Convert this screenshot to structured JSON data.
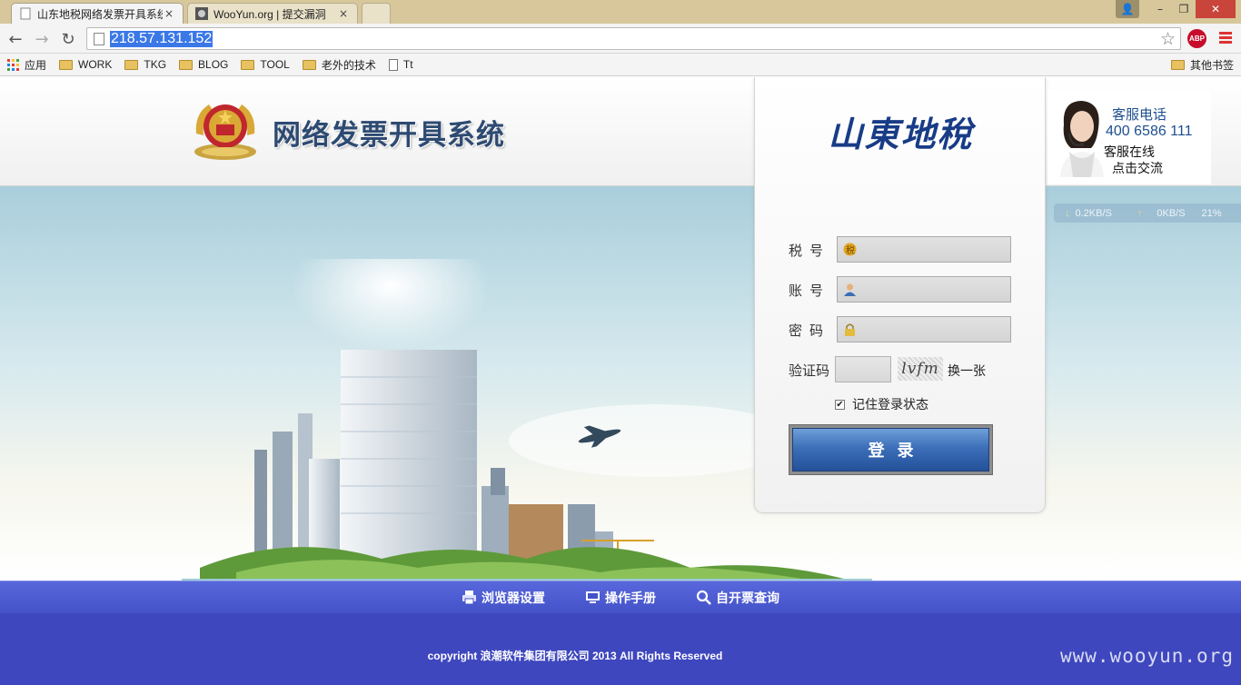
{
  "browser": {
    "tabs": [
      {
        "title": "山东地税网络发票开具系统",
        "active": true,
        "close": "×"
      },
      {
        "title": "WooYun.org | 提交漏洞",
        "active": false,
        "close": "×"
      }
    ],
    "window_controls": {
      "user": "👤",
      "minimize": "–",
      "restore": "❐",
      "close": "✕"
    },
    "nav": {
      "back": "←",
      "forward": "→",
      "reload": "↻"
    },
    "url": "218.57.131.152",
    "bookmark_star": "☆",
    "abp_label": "ABP",
    "bookmarks": [
      {
        "label": "应用",
        "icon": "apps-icon"
      },
      {
        "label": "WORK",
        "icon": "folder-icon"
      },
      {
        "label": "TKG",
        "icon": "folder-icon"
      },
      {
        "label": "BLOG",
        "icon": "folder-icon"
      },
      {
        "label": "TOOL",
        "icon": "folder-icon"
      },
      {
        "label": "老外的技术",
        "icon": "folder-icon"
      },
      {
        "label": "Tt",
        "icon": "page-icon"
      }
    ],
    "other_bookmarks": "其他书签"
  },
  "header": {
    "title": "网络发票开具系统"
  },
  "login": {
    "logo_text": "山東地稅",
    "fields": [
      {
        "label": "税号",
        "icon": "tax-icon",
        "value": ""
      },
      {
        "label": "账号",
        "icon": "user-icon",
        "value": ""
      },
      {
        "label": "密码",
        "icon": "lock-icon",
        "value": ""
      }
    ],
    "captcha_label": "验证码",
    "captcha_code": "lvfm",
    "captcha_refresh": "换一张",
    "remember_label": "记住登录状态",
    "remember_checked": true,
    "submit_label": "登录"
  },
  "customer_service": {
    "title": "客服电话",
    "phone": "400 6586 111",
    "online": "客服在线",
    "chat": "点击交流"
  },
  "speed_widget": {
    "down_arrow": "↓",
    "down": "0.2KB/S",
    "up_arrow": "↑",
    "up": "0KB/S",
    "percent": "21%"
  },
  "footer": {
    "links": [
      {
        "label": "浏览器设置",
        "icon": "printer-icon"
      },
      {
        "label": "操作手册",
        "icon": "monitor-icon"
      },
      {
        "label": "自开票查询",
        "icon": "search-icon"
      }
    ],
    "copyright": "copyright 浪潮软件集团有限公司 2013 All Rights Reserved",
    "watermark": "www.wooyun.org"
  },
  "colors": {
    "tabbar": "#d7c79a",
    "brand_blue": "#2d4a72",
    "login_button": "#3d6fb9",
    "footer": "#3e47be"
  }
}
